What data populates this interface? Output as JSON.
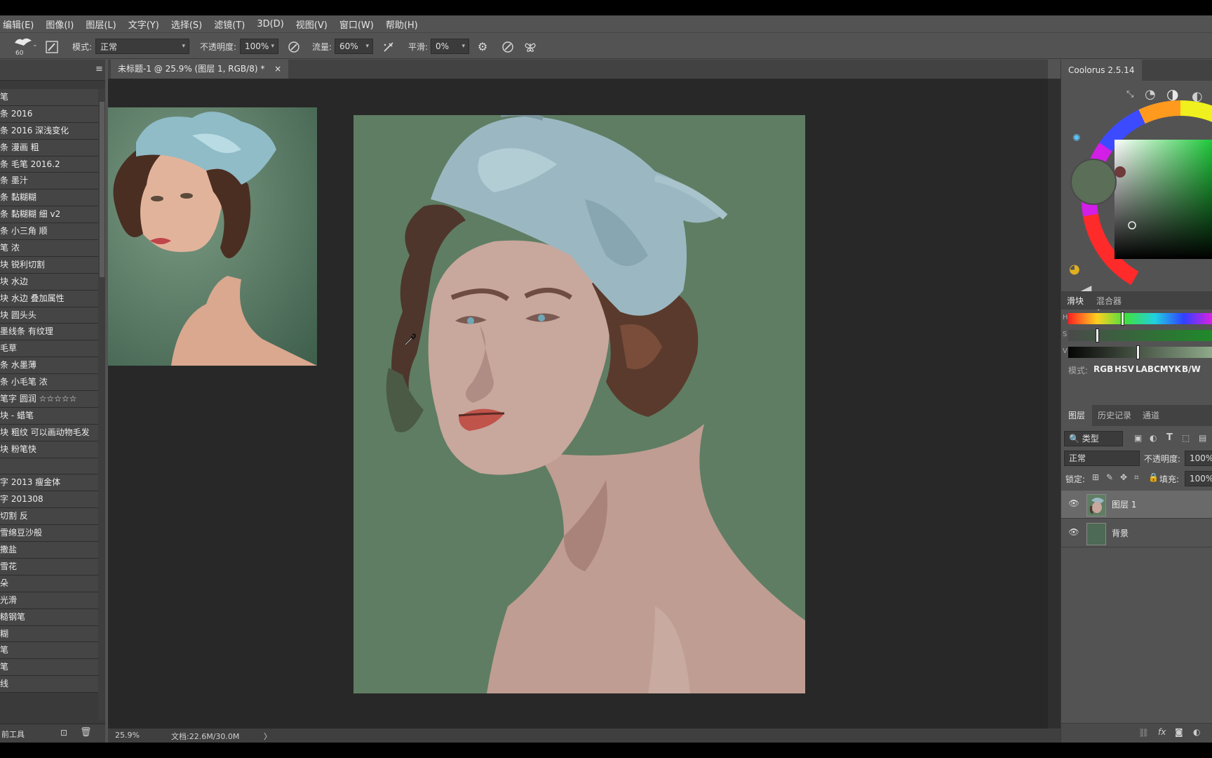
{
  "menu": [
    "编辑(E)",
    "图像(I)",
    "图层(L)",
    "文字(Y)",
    "选择(S)",
    "滤镜(T)",
    "3D(D)",
    "视图(V)",
    "窗口(W)",
    "帮助(H)"
  ],
  "options": {
    "brush_size": "60",
    "mode_label": "模式:",
    "mode_value": "正常",
    "opacity_label": "不透明度:",
    "opacity_value": "100%",
    "flow_label": "流量:",
    "flow_value": "60%",
    "smooth_label": "平滑:",
    "smooth_value": "0%"
  },
  "brush_list": [
    "笔",
    "条 2016",
    "条 2016 深浅变化",
    "条 漫画 粗",
    "条 毛笔 2016.2",
    "条 墨汁",
    "条 黏糊糊",
    "条 黏糊糊 细 v2",
    "条 小三角 顺",
    "笔 浓",
    "块 锐利切割",
    "块 水边",
    "块 水边 叠加属性",
    "块 圆头头",
    "墨线条 有纹理",
    "毛草",
    "条 水墨薄",
    "条 小毛笔 浓",
    "笔字 圆润 ☆☆☆☆☆",
    "块 - 蜡笔",
    "块 粗纹 可以画动物毛发",
    "块 粉笔快",
    "",
    "字 2013 瘦金体",
    "字 201308",
    "切割 反",
    "雪绵豆沙般",
    "撒盐",
    "雪花",
    "朵",
    "光滑",
    "糙钢笔",
    "糊",
    "笔",
    "笔",
    "线"
  ],
  "left_footer": "前工具",
  "document": {
    "tab_title": "未标题-1 @ 25.9% (图层 1, RGB/8) *",
    "tab_close": "×",
    "zoom": "25.9%",
    "doc_size": "文档:22.6M/30.0M",
    "status_arrow": "〉"
  },
  "coolorus": {
    "tab_title": "Coolorus 2.5.14",
    "sliders_tab": "滑块",
    "mixer_tab": "混合器",
    "mode_label": "模式:",
    "modes": [
      "RGB",
      "HSV",
      "LAB",
      "CMYK",
      "B/W"
    ],
    "slider_letters": [
      "H",
      "S",
      "V"
    ],
    "current_color": "#5b6e58",
    "hue": 0.52,
    "saturation": 0.2,
    "value": 0.55
  },
  "layers_panel": {
    "tabs": [
      "图层",
      "历史记录",
      "通道"
    ],
    "filter_label": "类型",
    "blend_mode": "正常",
    "opacity_label": "不透明度:",
    "opacity_value": "100%",
    "lock_label": "锁定:",
    "fill_label": "填充:",
    "fill_value": "100%",
    "layers": [
      {
        "name": "图层 1",
        "selected": true
      },
      {
        "name": "背景",
        "selected": false
      }
    ]
  },
  "colors": {
    "canvas_bg": "#5f7d63",
    "ribbon": "#9bb8c2",
    "skin": "#c8a79d",
    "hair": "#4e362d",
    "lips": "#c0534a"
  }
}
